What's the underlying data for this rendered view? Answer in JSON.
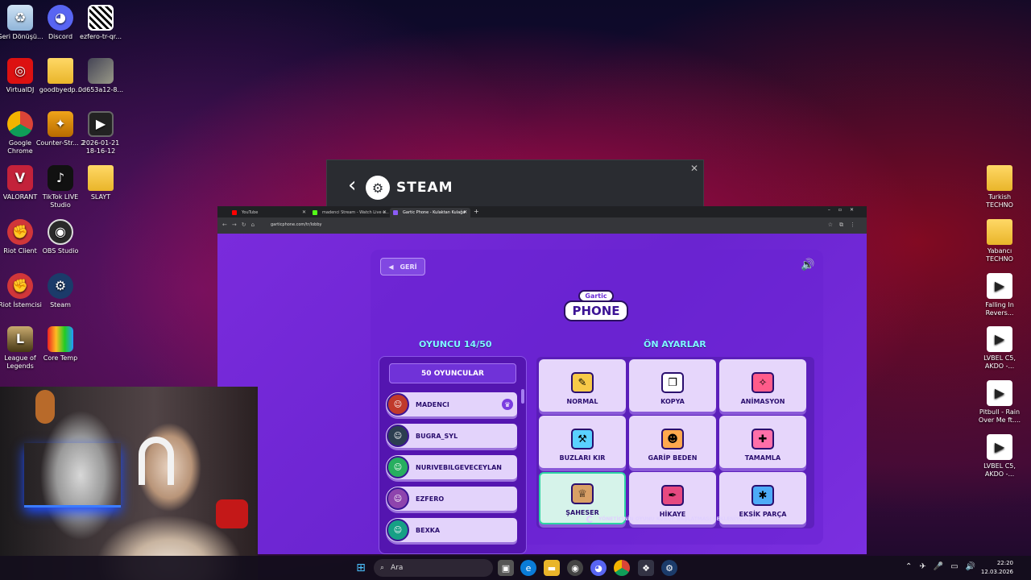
{
  "desktop": {
    "icons": [
      {
        "label": "Geri Dönüşü...",
        "icon": "recycle-bin-icon"
      },
      {
        "label": "Discord",
        "icon": "discord-icon"
      },
      {
        "label": "ezfero-tr-qr...",
        "icon": "qr-code-icon"
      },
      {
        "label": "VirtualDJ",
        "icon": "virtualdj-icon"
      },
      {
        "label": "goodbyedp...",
        "icon": "folder-icon"
      },
      {
        "label": "0d653a12-8...",
        "icon": "image-file-icon"
      },
      {
        "label": "Google Chrome",
        "icon": "chrome-icon"
      },
      {
        "label": "Counter-Str... 2",
        "icon": "counter-strike-icon"
      },
      {
        "label": "2026-01-21 18-16-12",
        "icon": "video-file-icon"
      },
      {
        "label": "VALORANT",
        "icon": "valorant-icon"
      },
      {
        "label": "TikTok LIVE Studio",
        "icon": "tiktok-icon"
      },
      {
        "label": "SLAYT",
        "icon": "folder-icon"
      },
      {
        "label": "Riot Client",
        "icon": "riot-icon"
      },
      {
        "label": "OBS Studio",
        "icon": "obs-icon"
      },
      {
        "label": "Riot İstemcisi",
        "icon": "riot-icon"
      },
      {
        "label": "Steam",
        "icon": "steam-icon"
      },
      {
        "label": "League of Legends",
        "icon": "lol-icon"
      },
      {
        "label": "Core Temp",
        "icon": "core-temp-icon"
      },
      {
        "label": "Turkish TECHNO",
        "icon": "folder-icon"
      },
      {
        "label": "Yabancı TECHNO",
        "icon": "folder-icon"
      },
      {
        "label": "Falling In Revers...",
        "icon": "media-file-icon"
      },
      {
        "label": "LVBEL C5, AKDO -...",
        "icon": "media-file-icon"
      },
      {
        "label": "Pitbull - Rain Over Me ft....",
        "icon": "media-file-icon"
      },
      {
        "label": "LVBEL C5, AKDO -...",
        "icon": "media-file-icon"
      }
    ]
  },
  "steam_popup": {
    "title": "STEAM",
    "close": "✕"
  },
  "browser": {
    "tabs": [
      {
        "label": "YouTube",
        "color": "#ff0000",
        "active": false
      },
      {
        "label": "madenci Stream - Watch Live o...",
        "color": "#53fc18",
        "active": false
      },
      {
        "label": "Gartic Phone - Kulaktan Kulağa",
        "color": "#8b5cf6",
        "active": true
      }
    ],
    "new_tab": "+",
    "url": "garticphone.com/tr/lobby"
  },
  "game": {
    "back_label": "GERİ",
    "logo_top": "Gartic",
    "logo_main": "PHONE",
    "players_heading": "OYUNCU 14/50",
    "presets_heading": "ÖN AYARLAR",
    "player_count_button": "50 OYUNCULAR",
    "players": [
      {
        "name": "MADENCI",
        "avatar_color": "#c0392b",
        "host": true
      },
      {
        "name": "BUGRA_SYL",
        "avatar_color": "#2c3e50",
        "host": false
      },
      {
        "name": "NURIVEBILGEVECEYLAN",
        "avatar_color": "#27ae60",
        "host": false
      },
      {
        "name": "EZFERO",
        "avatar_color": "#8e44ad",
        "host": false
      },
      {
        "name": "BEXKA",
        "avatar_color": "#16a085",
        "host": false
      }
    ],
    "presets": [
      {
        "label": "NORMAL",
        "icon": "notepad-pencil-icon",
        "color": "#f7c948",
        "selected": false
      },
      {
        "label": "KOPYA",
        "icon": "copy-cards-icon",
        "color": "#ffffff",
        "selected": false
      },
      {
        "label": "ANİMASYON",
        "icon": "animation-wand-icon",
        "color": "#ff5c8a",
        "selected": false
      },
      {
        "label": "BUZLARI KIR",
        "icon": "ice-hammer-icon",
        "color": "#5ad1ff",
        "selected": false
      },
      {
        "label": "GARİP BEDEN",
        "icon": "body-parts-icon",
        "color": "#ffa94d",
        "selected": false
      },
      {
        "label": "TAMAMLA",
        "icon": "complete-drawing-icon",
        "color": "#ff6fa8",
        "selected": false
      },
      {
        "label": "ŞAHESER",
        "icon": "masterpiece-painting-icon",
        "color": "#d9a066",
        "selected": true
      },
      {
        "label": "HİKAYE",
        "icon": "story-scroll-icon",
        "color": "#e64980",
        "selected": false
      },
      {
        "label": "EKSİK PARÇA",
        "icon": "missing-piece-icon",
        "color": "#4dabf7",
        "selected": false
      }
    ],
    "waiting_text": "YÖNETİCİNİN OYUNU KURUP BAŞLATMASI BEKLENİYOR ;)"
  },
  "taskbar": {
    "search_placeholder": "Ara",
    "time": "22:20",
    "date": "12.03.2026"
  }
}
